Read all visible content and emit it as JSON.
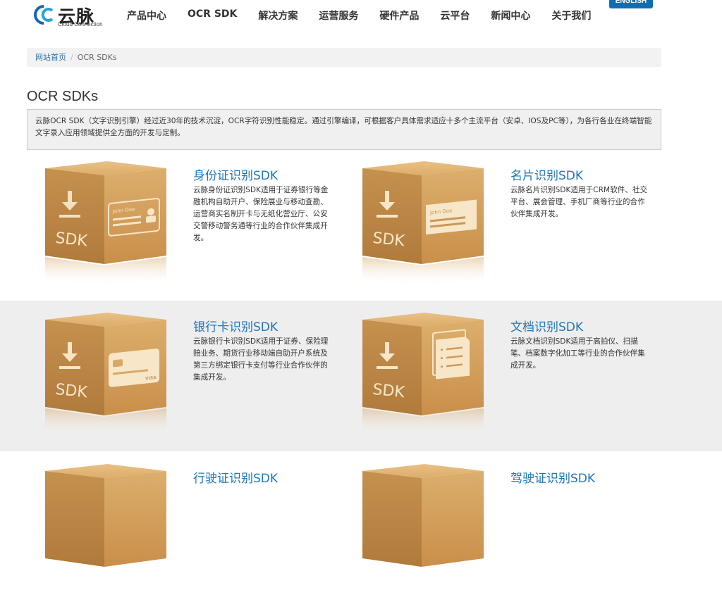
{
  "logo": {
    "name": "云脉",
    "sub": "Cloud Connection"
  },
  "nav": [
    "产品中心",
    "OCR SDK",
    "解决方案",
    "运营服务",
    "硬件产品",
    "云平台",
    "新闻中心",
    "关于我们"
  ],
  "language_button": "ENGLISH",
  "breadcrumb": {
    "home": "网站首页",
    "separator": "/",
    "current": "OCR SDKs"
  },
  "page_title": "OCR SDKs",
  "intro": "云脉OCR SDK（文字识别引擎）经过近30年的技术沉淀，OCR字符识别性能稳定。通过引擎编译，可根据客户具体需求适应十多个主流平台（安卓、IOS及PC等），为各行各业在终端智能文字录入应用领域提供全方面的开发与定制。",
  "box_label": "SDK",
  "id_card_sample": "John Doe",
  "card_sample_text": "John Doe",
  "bank_card_brand": "VISA",
  "products": [
    {
      "title": "身份证识别SDK",
      "desc": "云脉身份证识别SDK适用于证券银行等金融机构自助开户、保险展业与移动查勘、运营商实名制开卡与无纸化营业厅、公安 交警移动警务通等行业的合作伙伴集成开发。",
      "icon": "id-card"
    },
    {
      "title": "名片识别SDK",
      "desc": "云脉名片识别SDK适用于CRM软件、社交平台、展会管理、手机厂商等行业的合作伙伴集成开发。",
      "icon": "business-card"
    },
    {
      "title": "银行卡识别SDK",
      "desc": "云脉银行卡识别SDK适用于证券、保险理赔业务、期货行业移动端自助开户系统及第三方绑定银行卡支付等行业合作伙伴的集成开发。",
      "icon": "bank-card"
    },
    {
      "title": "文档识别SDK",
      "desc": "云脉文档识别SDK适用于高拍仪、扫描笔、档案数字化加工等行业的合作伙伴集成开发。",
      "icon": "document"
    },
    {
      "title": "行驶证识别SDK",
      "desc": "",
      "icon": "vehicle-license"
    },
    {
      "title": "驾驶证识别SDK",
      "desc": "",
      "icon": "driver-license"
    }
  ],
  "colors": {
    "brand_blue": "#1f76b9",
    "box": "#d9a866",
    "band_gray": "#eeeeee"
  }
}
